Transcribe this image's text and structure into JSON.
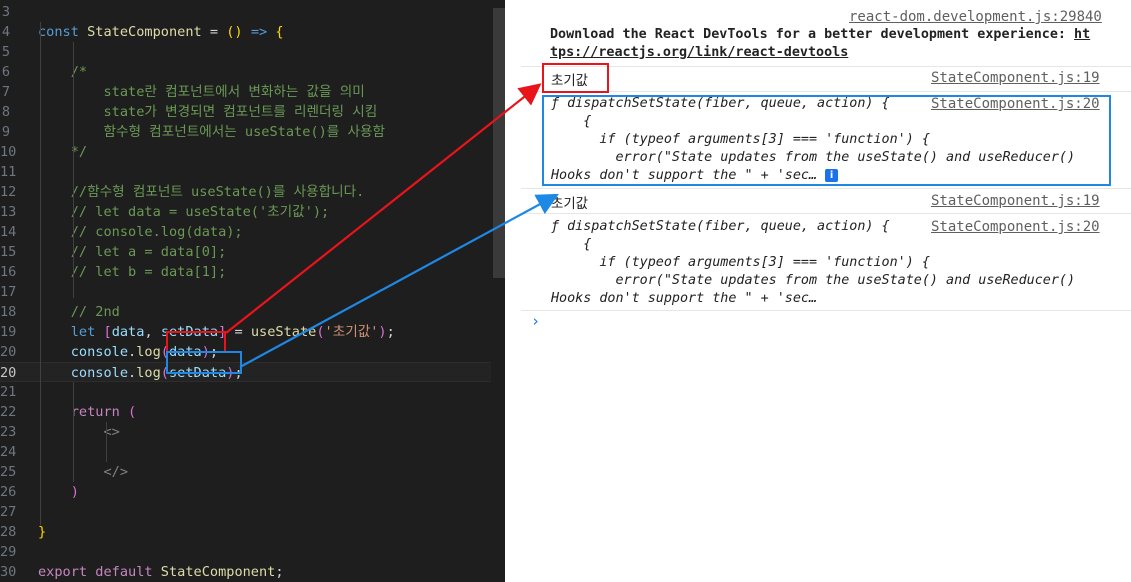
{
  "editor": {
    "lines": [
      {
        "n": "3",
        "html": ""
      },
      {
        "n": "4",
        "html": "<span class='kw'>const</span> <span class='fn'>StateComponent</span> = <span class='br1'>()</span> <span class='kw'>=&gt;</span> <span class='br1'>{</span>"
      },
      {
        "n": "5",
        "html": ""
      },
      {
        "n": "6",
        "html": "    <span class='cm'>/*</span>"
      },
      {
        "n": "7",
        "html": "        <span class='cm'>state란 컴포넌트에서 변화하는 값을 의미</span>"
      },
      {
        "n": "8",
        "html": "        <span class='cm'>state가 변경되면 컴포넌트를 리렌더링 시킴</span>"
      },
      {
        "n": "9",
        "html": "        <span class='cm'>함수형 컴포넌트에서는 useState()를 사용함</span>"
      },
      {
        "n": "10",
        "html": "    <span class='cm'>*/</span>"
      },
      {
        "n": "11",
        "html": ""
      },
      {
        "n": "12",
        "html": "    <span class='cm'>//함수형 컴포넌트 useState()를 사용합니다.</span>"
      },
      {
        "n": "13",
        "html": "    <span class='cm'>// let data = useState('초기값');</span>"
      },
      {
        "n": "14",
        "html": "    <span class='cm'>// console.log(data);</span>"
      },
      {
        "n": "15",
        "html": "    <span class='cm'>// let a = data[0];</span>"
      },
      {
        "n": "16",
        "html": "    <span class='cm'>// let b = data[1];</span>"
      },
      {
        "n": "17",
        "html": ""
      },
      {
        "n": "18",
        "html": "    <span class='cm'>// 2nd</span>"
      },
      {
        "n": "19",
        "html": "    <span class='kw'>let</span> <span class='br2'>[</span><span class='var'>data</span>, <span class='var'>setData</span><span class='br2'>]</span> = <span class='fn'>useState</span><span class='br2'>(</span><span class='str'>'초기값'</span><span class='br2'>)</span>;"
      },
      {
        "n": "20",
        "html": "    <span class='var'>console</span>.<span class='fn'>log</span><span class='br2'>(</span><span class='var'>data</span><span class='br2'>)</span>;"
      },
      {
        "n": "20",
        "html": "    <span class='var'>console</span>.<span class='fn'>log</span><span class='br2'>(</span><span class='var'>setData</span><span class='br2'>)</span>;",
        "current": true
      },
      {
        "n": "21",
        "html": ""
      },
      {
        "n": "22",
        "html": "    <span class='ctrl'>return</span> <span class='br2'>(</span>"
      },
      {
        "n": "23",
        "html": "        <span class='tag'>&lt;&gt;</span>"
      },
      {
        "n": "24",
        "html": ""
      },
      {
        "n": "25",
        "html": "        <span class='tag'>&lt;/&gt;</span>"
      },
      {
        "n": "26",
        "html": "    <span class='br2'>)</span>"
      },
      {
        "n": "27",
        "html": ""
      },
      {
        "n": "28",
        "html": "<span class='br1'>}</span>"
      },
      {
        "n": "29",
        "html": ""
      },
      {
        "n": "30",
        "html": "<span class='ctrl'>export</span> <span class='ctrl'>default</span> <span class='fn'>StateComponent</span>;"
      }
    ]
  },
  "console": {
    "banner_source": "react-dom.development.js:29840",
    "banner_line1": "Download the React DevTools for a better development experience: ",
    "banner_link1": "ht",
    "banner_link2": "tps://reactjs.org/link/react-devtools",
    "log1_text": "초기값",
    "log1_source": "StateComponent.js:19",
    "log2_source": "StateComponent.js:20",
    "fn_line1": "ƒ dispatchSetState(fiber, queue, action) {",
    "fn_line2": "    {",
    "fn_line3": "      if (typeof arguments[3] === 'function') {",
    "fn_line4": "        error(\"State updates from the useState() and useReducer()",
    "fn_line5": "Hooks don't support the \" + 'sec…",
    "info_icon_label": "i",
    "log3_text": "초기값",
    "log3_source": "StateComponent.js:19",
    "log4_source": "StateComponent.js:20",
    "prompt_symbol": "›"
  },
  "colors": {
    "annotation_red": "#e8141a",
    "annotation_blue": "#1e88e5"
  }
}
